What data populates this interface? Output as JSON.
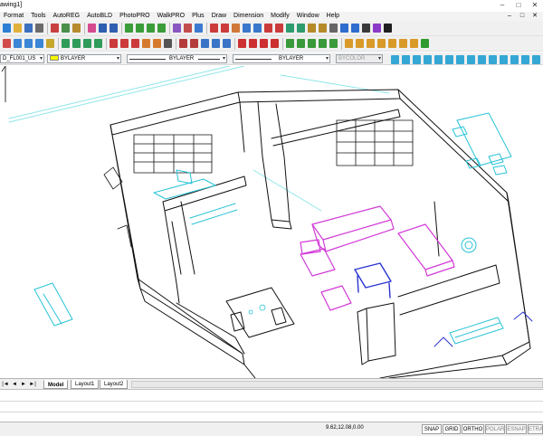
{
  "window": {
    "title": "awing1]",
    "controls": [
      "–",
      "□",
      "✕"
    ]
  },
  "menubar": {
    "items": [
      "Format",
      "Tools",
      "AutoREG",
      "AutoBLD",
      "PhotoPRO",
      "WalkPRO",
      "Plus",
      "Draw",
      "Dimension",
      "Modify",
      "Window",
      "Help"
    ],
    "mdi_controls": [
      "–",
      "□",
      "✕"
    ]
  },
  "properties": {
    "layer": "D_FL001_US",
    "color": "BYLAYER",
    "linetype": "BYLAYER",
    "lineweight": "BYLAYER",
    "plotstyle": "BYCOLOR",
    "color_swatch": "#f6f600"
  },
  "tabs": {
    "nav_buttons": [
      "|◄",
      "◄",
      "►",
      "►|"
    ],
    "items": [
      "Model",
      "Layout1",
      "Layout2"
    ],
    "active": "Model"
  },
  "status": {
    "coordinates": "9.62,12.08,0.00",
    "toggles": [
      {
        "label": "SNAP",
        "on": true
      },
      {
        "label": "GRID",
        "on": true
      },
      {
        "label": "ORTHO",
        "on": true
      },
      {
        "label": "POLAR",
        "on": false
      },
      {
        "label": "ESNAP",
        "on": false
      },
      {
        "label": "ETRA",
        "on": false
      }
    ]
  },
  "colors": {
    "wall": "#111111",
    "furniture_magenta": "#d23ad8",
    "furniture_cyan": "#28c3d6",
    "blue": "#2b34d0",
    "guide_cyan": "#8fe6ea"
  }
}
